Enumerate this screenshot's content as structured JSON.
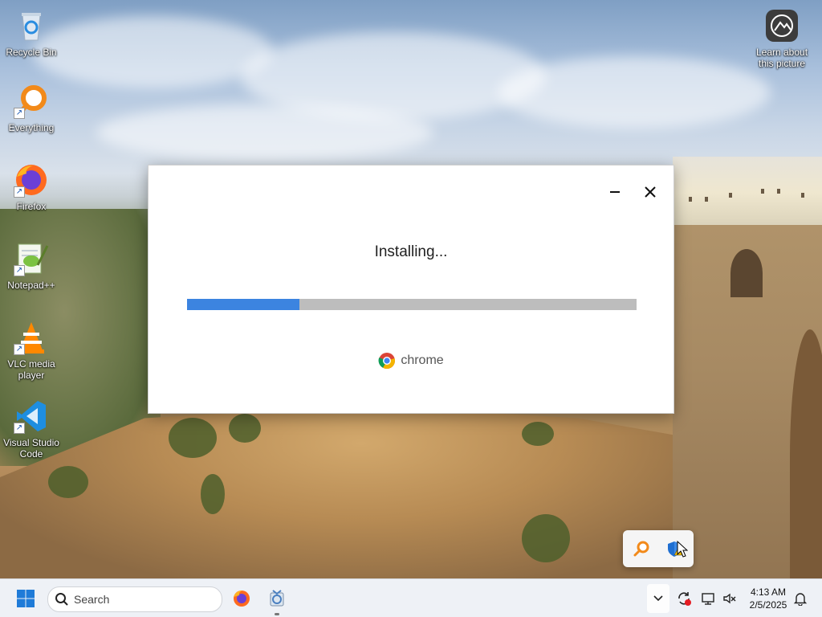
{
  "desktop": {
    "icons": [
      {
        "label": "Recycle Bin",
        "icon": "recycle-bin-icon"
      },
      {
        "label": "Everything",
        "icon": "everything-search-icon"
      },
      {
        "label": "Firefox",
        "icon": "firefox-icon"
      },
      {
        "label": "Notepad++",
        "icon": "notepad-plus-plus-icon"
      },
      {
        "label": "VLC media player",
        "icon": "vlc-icon"
      },
      {
        "label": "Visual Studio Code",
        "icon": "vscode-icon"
      }
    ],
    "learn_about": "Learn about this picture"
  },
  "installer": {
    "status": "Installing...",
    "progress_fraction": 0.25,
    "brand": "chrome",
    "colors": {
      "progress": "#3c84e0",
      "track": "#bdbdbd"
    }
  },
  "taskbar": {
    "search_placeholder": "Search",
    "time": "4:13 AM",
    "date": "2/5/2025"
  }
}
